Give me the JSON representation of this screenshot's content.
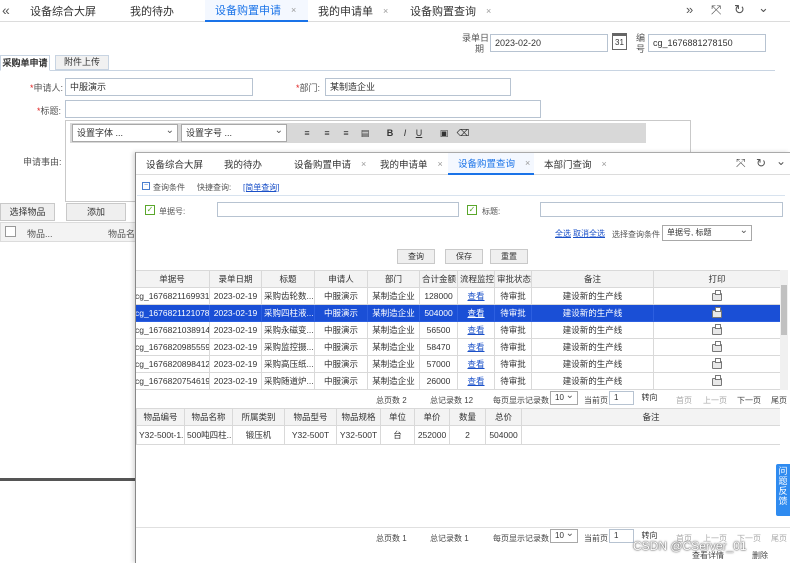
{
  "back_tabs": {
    "nav_left": "«",
    "items": [
      {
        "label": "设备综合大屏"
      },
      {
        "label": "我的待办"
      },
      {
        "label": "设备购置申请",
        "active": true
      },
      {
        "label": "我的申请单"
      },
      {
        "label": "设备购置查询"
      }
    ],
    "close_mark": "×",
    "controls": [
      "»",
      "⤧",
      "↻",
      "⌄"
    ]
  },
  "back_form": {
    "date_label_1": "录单日",
    "date_label_2": "期",
    "date_value": "2023-02-20",
    "calendar_day": "31",
    "code_label_1": "编",
    "code_label_2": "号",
    "code_value": "cg_1676881278150",
    "subtabs": [
      "采购单申请",
      "附件上传"
    ],
    "applicant_label": "申请人:",
    "applicant_value": "中服演示",
    "dept_label": "部门:",
    "dept_value": "某制造企业",
    "title_label": "标题:",
    "font_placeholder": "设置字体 ...",
    "size_placeholder": "设置字号 ...",
    "reason_label": "申请事由:",
    "select_item_btn": "选择物品",
    "add_btn": "添加",
    "items_col1": "物品...",
    "items_col2": "物品名"
  },
  "front_tabs": {
    "items": [
      {
        "label": "设备综合大屏"
      },
      {
        "label": "我的待办"
      },
      {
        "label": "设备购置申请"
      },
      {
        "label": "我的申请单"
      },
      {
        "label": "设备购置查询",
        "active": true
      },
      {
        "label": "本部门查询"
      }
    ],
    "close_mark": "×",
    "controls": [
      "⤧",
      "↻",
      "⌄"
    ]
  },
  "query": {
    "conditions_label": "查询条件",
    "quick_label": "快捷查询:",
    "simple_link": "[简单查询]",
    "order_label": "单据号:",
    "title_label": "标题:",
    "select_all": "全选",
    "deselect_all": "取消全选",
    "choose_label": "选择查询条件",
    "choose_value": "单据号, 标题",
    "query_btn": "查询",
    "save_btn": "保存",
    "reset_btn": "重置"
  },
  "table": {
    "headers": [
      "单据号",
      "录单日期",
      "标题",
      "申请人",
      "部门",
      "合计金额",
      "流程监控",
      "审批状态",
      "备注",
      "打印"
    ],
    "rows": [
      [
        "cg_1676821169931",
        "2023-02-19",
        "采购齿轮数...",
        "中服演示",
        "某制造企业",
        "128000",
        "查看",
        "待审批",
        "建设新的生产线"
      ],
      [
        "cg_1676821121078",
        "2023-02-19",
        "采购四柱液...",
        "中服演示",
        "某制造企业",
        "504000",
        "查看",
        "待审批",
        "建设新的生产线"
      ],
      [
        "cg_1676821038914",
        "2023-02-19",
        "采购永磁变...",
        "中服演示",
        "某制造企业",
        "56500",
        "查看",
        "待审批",
        "建设新的生产线"
      ],
      [
        "cg_1676820985559",
        "2023-02-19",
        "采购监控摄...",
        "中服演示",
        "某制造企业",
        "58470",
        "查看",
        "待审批",
        "建设新的生产线"
      ],
      [
        "cg_1676820898412",
        "2023-02-19",
        "采购高压纸...",
        "中服演示",
        "某制造企业",
        "57000",
        "查看",
        "待审批",
        "建设新的生产线"
      ],
      [
        "cg_1676820754619",
        "2023-02-19",
        "采购随道炉...",
        "中服演示",
        "某制造企业",
        "26000",
        "查看",
        "待审批",
        "建设新的生产线"
      ]
    ],
    "selected_row": 1
  },
  "pager1": {
    "total_pages": "总页数 2",
    "total_records": "总记录数 12",
    "per_page_label": "每页显示记录数",
    "per_page": "10",
    "current_label": "当前页",
    "current": "1",
    "goto": "转向",
    "first": "首页",
    "prev": "上一页",
    "next": "下一页",
    "last": "尾页"
  },
  "detail_table": {
    "headers": [
      "物品编号",
      "物品名称",
      "所属类别",
      "物品型号",
      "物品规格",
      "单位",
      "单价",
      "数量",
      "总价",
      "备注"
    ],
    "rows": [
      [
        "Y32-500t-1...",
        "500吨四柱...",
        "锻压机",
        "Y32-500T",
        "Y32-500T",
        "台",
        "252000",
        "2",
        "504000",
        ""
      ]
    ]
  },
  "pager2": {
    "total_pages": "总页数 1",
    "total_records": "总记录数 1",
    "per_page_label": "每页显示记录数",
    "per_page": "10",
    "current_label": "当前页",
    "current": "1",
    "goto": "转向",
    "first": "首页",
    "prev": "上一页",
    "next": "下一页",
    "last": "尾页"
  },
  "bottom_btns": {
    "view": "查看详情",
    "delete": "删除"
  },
  "side_feedback": "问题反馈",
  "watermark": "CSDN @CServer_01",
  "colors": {
    "accent": "#1a73e8",
    "selected_row": "#1a4fd6",
    "link": "#1a50c8",
    "feedback": "#2f8bf0"
  }
}
